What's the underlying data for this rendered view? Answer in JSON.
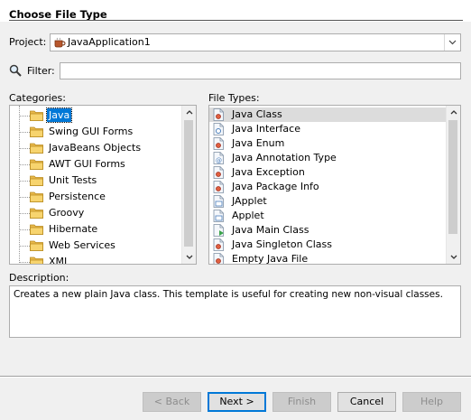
{
  "header": {
    "title": "Choose File Type"
  },
  "project": {
    "label": "Project:",
    "value": "JavaApplication1"
  },
  "filter": {
    "label": "Filter:",
    "value": ""
  },
  "categories": {
    "label": "Categories:",
    "items": [
      {
        "label": "Java",
        "selected": true
      },
      {
        "label": "Swing GUI Forms"
      },
      {
        "label": "JavaBeans Objects"
      },
      {
        "label": "AWT GUI Forms"
      },
      {
        "label": "Unit Tests"
      },
      {
        "label": "Persistence"
      },
      {
        "label": "Groovy"
      },
      {
        "label": "Hibernate"
      },
      {
        "label": "Web Services"
      },
      {
        "label": "XML"
      }
    ]
  },
  "file_types": {
    "label": "File Types:",
    "items": [
      {
        "label": "Java Class",
        "icon": "java-class-icon",
        "selected": true
      },
      {
        "label": "Java Interface",
        "icon": "java-interface-icon"
      },
      {
        "label": "Java Enum",
        "icon": "java-enum-icon"
      },
      {
        "label": "Java Annotation Type",
        "icon": "java-annotation-icon"
      },
      {
        "label": "Java Exception",
        "icon": "java-exception-icon"
      },
      {
        "label": "Java Package Info",
        "icon": "java-package-info-icon"
      },
      {
        "label": "JApplet",
        "icon": "japplet-icon"
      },
      {
        "label": "Applet",
        "icon": "applet-icon"
      },
      {
        "label": "Java Main Class",
        "icon": "java-main-class-icon"
      },
      {
        "label": "Java Singleton Class",
        "icon": "java-singleton-icon"
      },
      {
        "label": "Empty Java File",
        "icon": "empty-java-file-icon"
      }
    ]
  },
  "description": {
    "label": "Description:",
    "text": "Creates a new plain Java class. This template is useful for creating new non-visual classes."
  },
  "buttons": {
    "back": "< Back",
    "next": "Next >",
    "finish": "Finish",
    "cancel": "Cancel",
    "help": "Help"
  },
  "colors": {
    "selection": "#0078d7",
    "background": "#f0f0f0"
  }
}
